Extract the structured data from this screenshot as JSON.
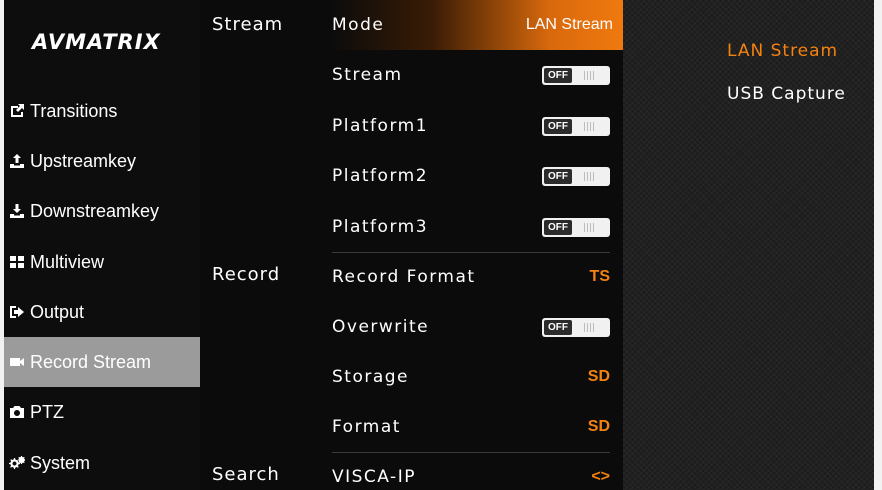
{
  "brand": {
    "logo_text": "AVMATRIX"
  },
  "sidebar": {
    "items": [
      {
        "label": "Transitions",
        "icon": "share-icon"
      },
      {
        "label": "Upstreamkey",
        "icon": "upload-icon"
      },
      {
        "label": "Downstreamkey",
        "icon": "download-icon"
      },
      {
        "label": "Multiview",
        "icon": "grid-icon"
      },
      {
        "label": "Output",
        "icon": "sign-out-icon"
      },
      {
        "label": "Record Stream",
        "icon": "video-camera-icon",
        "active": true
      },
      {
        "label": "PTZ",
        "icon": "camera-icon"
      },
      {
        "label": "System",
        "icon": "gears-icon"
      }
    ]
  },
  "settings": {
    "categories": {
      "stream": "Stream",
      "record": "Record",
      "search": "Search"
    },
    "rows": [
      {
        "label": "Mode",
        "value": "LAN Stream"
      },
      {
        "label": "Stream",
        "toggle": "OFF"
      },
      {
        "label": "Platform1",
        "toggle": "OFF"
      },
      {
        "label": "Platform2",
        "toggle": "OFF"
      },
      {
        "label": "Platform3",
        "toggle": "OFF"
      },
      {
        "label": "Record Format",
        "value": "TS"
      },
      {
        "label": "Overwrite",
        "toggle": "OFF"
      },
      {
        "label": "Storage",
        "value": "SD"
      },
      {
        "label": "Format",
        "value": "SD"
      },
      {
        "label": "VISCA-IP",
        "value": "<>"
      }
    ]
  },
  "options": {
    "items": [
      "LAN Stream",
      "USB Capture"
    ],
    "selected": "LAN Stream"
  },
  "colors": {
    "accent": "#f5820f",
    "active_sidebar": "#9b9b9b",
    "background": "#0b0b0b"
  }
}
